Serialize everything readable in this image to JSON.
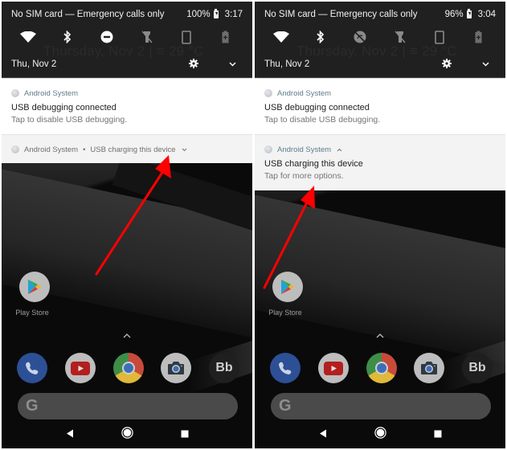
{
  "panels": [
    {
      "status": {
        "carrier": "No SIM card — Emergency calls only",
        "battery": "100%",
        "time": "3:17"
      },
      "quick_tiles": [
        "wifi-icon",
        "bluetooth-icon",
        "do-not-disturb-icon",
        "flashlight-off-icon",
        "auto-rotate-icon",
        "battery-saver-icon"
      ],
      "weather_ghost": "Thursday, Nov 2 | ≡ 29 °C",
      "date": "Thu, Nov 2",
      "notifications": [
        {
          "app": "Android System",
          "title": "USB debugging connected",
          "text": "Tap to disable USB debugging."
        },
        {
          "app": "Android System",
          "summary": "USB charging this device",
          "separator": "•",
          "expand": "⌄",
          "expanded": false
        }
      ]
    },
    {
      "status": {
        "carrier": "No SIM card — Emergency calls only",
        "battery": "96%",
        "time": "3:04"
      },
      "quick_tiles": [
        "wifi-icon",
        "bluetooth-icon",
        "data-saver-off-icon",
        "flashlight-off-icon",
        "auto-rotate-icon",
        "battery-saver-icon"
      ],
      "weather_ghost": "Thursday, Nov 2 | ≡ 29 °C",
      "date": "Thu, Nov 2",
      "notifications": [
        {
          "app": "Android System",
          "title": "USB debugging connected",
          "text": "Tap to disable USB debugging."
        },
        {
          "app": "Android System",
          "collapse": "^",
          "title": "USB charging this device",
          "text": "Tap for more options.",
          "expanded": true
        }
      ]
    }
  ],
  "home": {
    "play_store_label": "Play Store",
    "drawer_chevron": "^",
    "dock": [
      "Phone",
      "YouTube",
      "Chrome",
      "Camera",
      "Bb"
    ],
    "dock_bb_label": "Bb",
    "search_logo": "G"
  },
  "annotation": {
    "arrow_color": "#ff0000"
  }
}
